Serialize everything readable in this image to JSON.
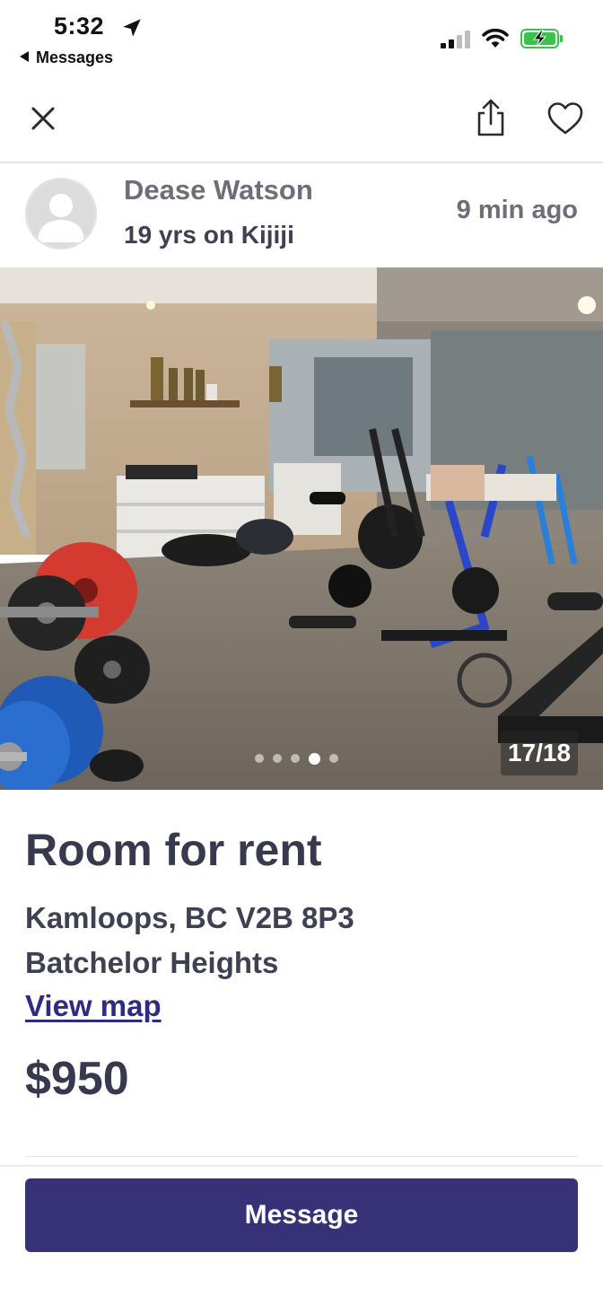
{
  "status_bar": {
    "time": "5:32",
    "back_app": "Messages",
    "icons": [
      "location-arrow-icon",
      "cellular-signal-icon",
      "wifi-icon",
      "battery-charging-icon"
    ],
    "battery_color": "#3ac24a"
  },
  "nav": {
    "icons": [
      "close-icon",
      "share-icon",
      "heart-icon"
    ]
  },
  "seller": {
    "name": "Dease Watson",
    "tenure": "19 yrs on Kijiji",
    "posted": "9 min  ago",
    "avatar_icon": "person-placeholder-icon"
  },
  "gallery": {
    "counter": "17/18",
    "current_index": 17,
    "total": 18,
    "dot_count": 5,
    "active_dot": 4
  },
  "listing": {
    "title": "Room for rent",
    "address_line1": "Kamloops, BC V2B 8P3",
    "address_line2": "Batchelor Heights",
    "view_map": "View map",
    "price": "$950"
  },
  "actions": {
    "message_label": "Message"
  },
  "colors": {
    "primary": "#373178",
    "link": "#2f2a82",
    "text_dark": "#373a4e",
    "text_muted": "#6e6e7a"
  }
}
